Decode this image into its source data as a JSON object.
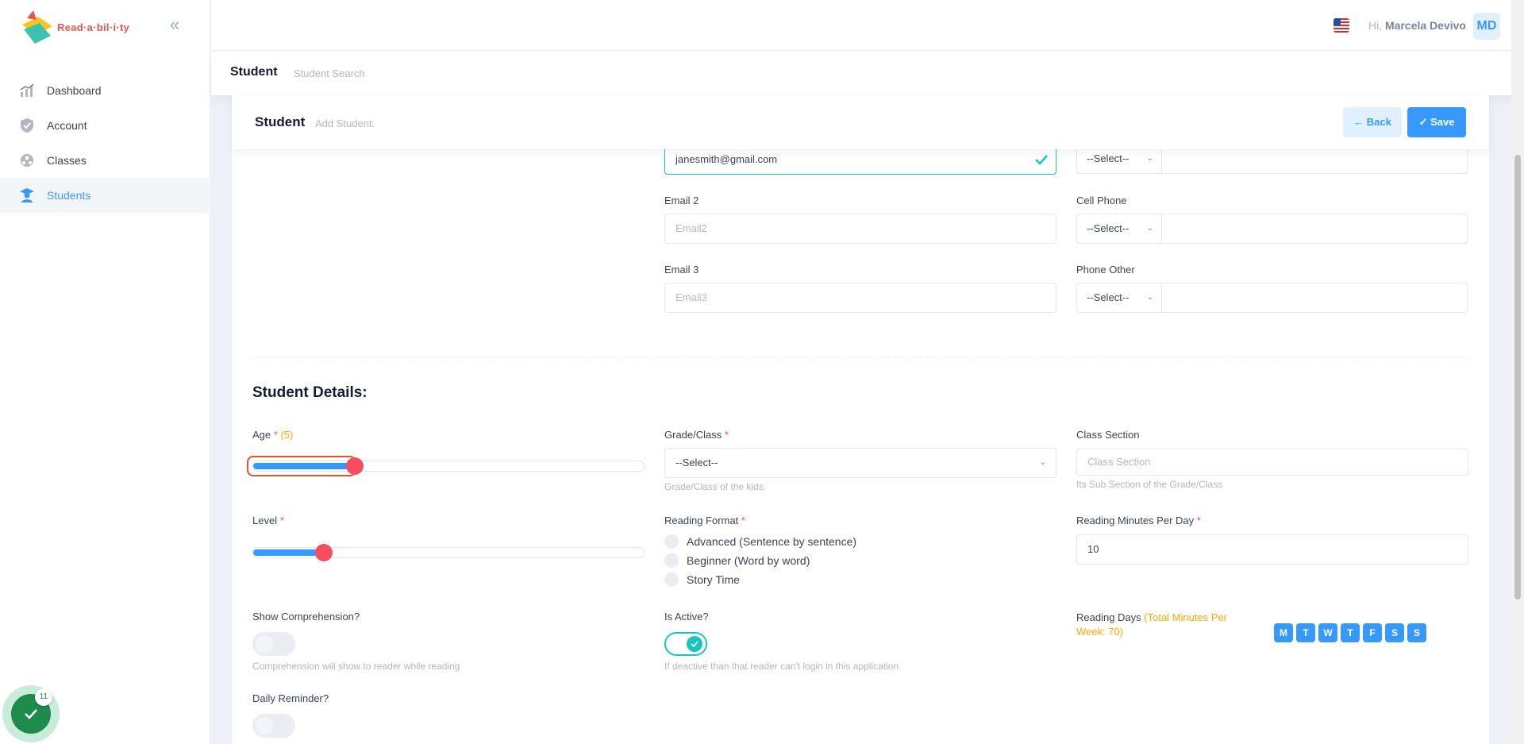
{
  "brand": {
    "logo_text": "Read·a·bil·i·ty"
  },
  "sidebar": {
    "items": [
      {
        "label": "Dashboard",
        "icon": "chart-icon"
      },
      {
        "label": "Account",
        "icon": "shield-icon"
      },
      {
        "label": "Classes",
        "icon": "classes-icon"
      },
      {
        "label": "Students",
        "icon": "student-icon",
        "active": true
      }
    ]
  },
  "header": {
    "greeting": "Hi,",
    "user_name": "Marcela Devivo",
    "avatar_initials": "MD"
  },
  "subheader": {
    "title": "Student",
    "subtitle": "Student Search"
  },
  "card": {
    "title": "Student",
    "subtitle": "Add Student.",
    "back_label": "← Back",
    "save_label": "✓ Save"
  },
  "contact": {
    "email1_value": "janesmith@gmail.com",
    "email2_label": "Email 2",
    "email2_placeholder": "Email2",
    "email3_label": "Email 3",
    "email3_placeholder": "Email3",
    "phone1_select": "--Select--",
    "cell_phone_label": "Cell Phone",
    "cell_phone_select": "--Select--",
    "phone_other_label": "Phone Other",
    "phone_other_select": "--Select--"
  },
  "details": {
    "section_title": "Student Details:",
    "age_label": "Age",
    "age_required": "*",
    "age_value": "(5)",
    "age_fraction": 0.26,
    "grade_label": "Grade/Class",
    "grade_required": "*",
    "grade_select": "--Select--",
    "grade_hint": "Grade/Class of the kids.",
    "class_section_label": "Class Section",
    "class_section_placeholder": "Class Section",
    "class_section_hint": "Its Sub Section of the Grade/Class",
    "level_label": "Level",
    "level_required": "*",
    "level_fraction": 0.18,
    "reading_format_label": "Reading Format",
    "reading_format_required": "*",
    "reading_format_options": [
      "Advanced (Sentence by sentence)",
      "Beginner (Word by word)",
      "Story Time"
    ],
    "reading_minutes_label": "Reading Minutes Per Day",
    "reading_minutes_required": "*",
    "reading_minutes_value": "10",
    "show_comprehension_label": "Show Comprehension?",
    "show_comprehension_on": false,
    "show_comprehension_hint": "Comprehension will show to reader while reading",
    "is_active_label": "Is Active?",
    "is_active_on": true,
    "is_active_hint": "If deactive than that reader can't login in this application",
    "reading_days_label": "Reading Days",
    "reading_days_total": "(Total Minutes Per Week: 70)",
    "days": [
      "M",
      "T",
      "W",
      "T",
      "F",
      "S",
      "S"
    ],
    "daily_reminder_label": "Daily Reminder?",
    "daily_reminder_on": false
  },
  "floating": {
    "badge": "11"
  },
  "colors": {
    "primary": "#3699ff",
    "danger": "#f64e60",
    "success": "#1bc5bd",
    "warning": "#ffa800"
  }
}
